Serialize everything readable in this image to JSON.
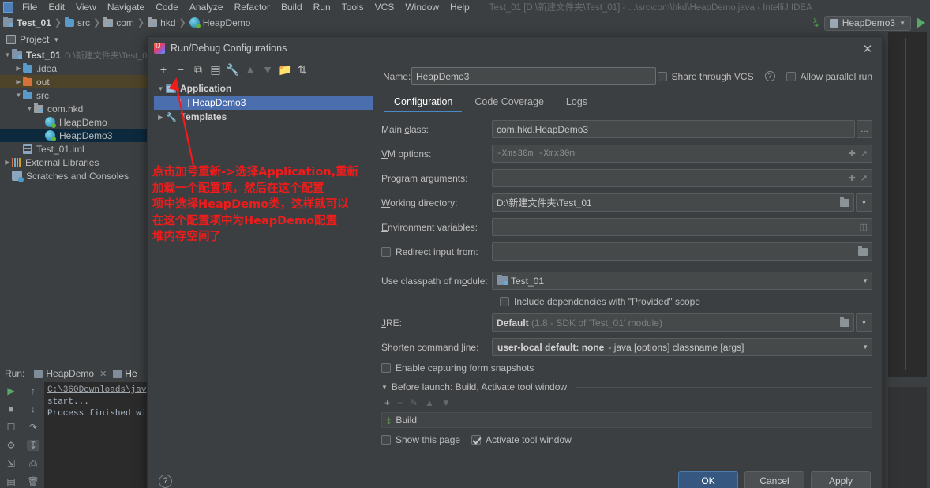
{
  "window": {
    "title": "Test_01 [D:\\新建文件夹\\Test_01] - ...\\src\\com\\hkd\\HeapDemo.java - IntelliJ IDEA",
    "menu": [
      "File",
      "Edit",
      "View",
      "Navigate",
      "Code",
      "Analyze",
      "Refactor",
      "Build",
      "Run",
      "Tools",
      "VCS",
      "Window",
      "Help"
    ]
  },
  "breadcrumb": [
    {
      "label": "Test_01",
      "icon": "module-icon"
    },
    {
      "label": "src",
      "icon": "folder-blue-icon"
    },
    {
      "label": "com",
      "icon": "folder-gray-icon"
    },
    {
      "label": "hkd",
      "icon": "folder-gray-icon"
    },
    {
      "label": "HeapDemo",
      "icon": "class-icon"
    }
  ],
  "toolbar": {
    "build_icon": "hammer-icon",
    "run_config": "HeapDemo3",
    "run_icon": "run-play-icon"
  },
  "project_panel": {
    "title": "Project",
    "tree": [
      {
        "label": "Test_01",
        "detail": "D:\\新建文件夹\\Test_0",
        "indent": 0,
        "arrow": "▼",
        "icon": "module-icon",
        "bold": true,
        "state": "none"
      },
      {
        "label": ".idea",
        "detail": "",
        "indent": 1,
        "arrow": "▶",
        "icon": "folder-blue-icon",
        "bold": false,
        "state": "none"
      },
      {
        "label": "out",
        "detail": "",
        "indent": 1,
        "arrow": "▶",
        "icon": "folder-orange-icon",
        "bold": false,
        "state": "highlight"
      },
      {
        "label": "src",
        "detail": "",
        "indent": 1,
        "arrow": "▼",
        "icon": "folder-blue-icon",
        "bold": false,
        "state": "none"
      },
      {
        "label": "com.hkd",
        "detail": "",
        "indent": 2,
        "arrow": "▼",
        "icon": "folder-gray-icon",
        "bold": false,
        "state": "none"
      },
      {
        "label": "HeapDemo",
        "detail": "",
        "indent": 3,
        "arrow": "",
        "icon": "class-icon",
        "bold": false,
        "state": "none"
      },
      {
        "label": "HeapDemo3",
        "detail": "",
        "indent": 3,
        "arrow": "",
        "icon": "class-icon",
        "bold": false,
        "state": "selected"
      },
      {
        "label": "Test_01.iml",
        "detail": "",
        "indent": 1,
        "arrow": "",
        "icon": "iml-icon",
        "bold": false,
        "state": "none"
      },
      {
        "label": "External Libraries",
        "detail": "",
        "indent": 0,
        "arrow": "▶",
        "icon": "library-icon",
        "bold": false,
        "state": "none"
      },
      {
        "label": "Scratches and Consoles",
        "detail": "",
        "indent": 0,
        "arrow": "",
        "icon": "scratches-icon",
        "bold": false,
        "state": "none"
      }
    ]
  },
  "run_tool_window": {
    "label": "Run:",
    "tabs": [
      {
        "label": "HeapDemo",
        "active": false
      },
      {
        "label": "He",
        "active": true
      }
    ],
    "console_lines": [
      "C:\\360Downloads\\jav",
      "start...",
      "",
      "Process finished wi"
    ],
    "toolbar_icons": [
      "rerun-icon",
      "stop-icon",
      "camera-icon",
      "settings-gear-icon",
      "export-icon",
      "layout-icon",
      "scroll-up-icon",
      "scroll-down-icon",
      "soft-wrap-icon",
      "scroll-to-end-icon",
      "print-icon",
      "trash-icon"
    ]
  },
  "dialog": {
    "title": "Run/Debug Configurations",
    "close_label": "✕",
    "toolbar": [
      {
        "name": "add-button",
        "glyph": "+",
        "disabled": false,
        "highlighted": true
      },
      {
        "name": "remove-button",
        "glyph": "−",
        "disabled": false,
        "highlighted": false
      },
      {
        "name": "copy-button",
        "glyph": "⧉",
        "disabled": false,
        "highlighted": false
      },
      {
        "name": "save-button",
        "glyph": "▤",
        "disabled": false,
        "highlighted": false
      },
      {
        "name": "edit-templates-button",
        "glyph": "🔧",
        "disabled": false,
        "highlighted": false
      },
      {
        "name": "move-up-button",
        "glyph": "▲",
        "disabled": true,
        "highlighted": false
      },
      {
        "name": "move-down-button",
        "glyph": "▼",
        "disabled": true,
        "highlighted": false
      },
      {
        "name": "new-folder-button",
        "glyph": "🗀",
        "disabled": false,
        "highlighted": false
      },
      {
        "name": "sort-button",
        "glyph": "⇅",
        "disabled": false,
        "highlighted": false
      }
    ],
    "config_tree": [
      {
        "label": "Application",
        "indent": 0,
        "arrow": "▼",
        "icon": "app-folder-icon",
        "bold": true,
        "selected": false
      },
      {
        "label": "HeapDemo3",
        "indent": 1,
        "arrow": "",
        "icon": "config-icon",
        "bold": false,
        "selected": true
      },
      {
        "label": "Templates",
        "indent": 0,
        "arrow": "▶",
        "icon": "wrench-icon",
        "bold": true,
        "selected": false
      }
    ],
    "name_label": "Name:",
    "name_value": "HeapDemo3",
    "share_vcs_label": "Share through VCS",
    "share_vcs_checked": false,
    "allow_parallel_label": "Allow parallel run",
    "allow_parallel_checked": false,
    "tabs": [
      {
        "label": "Configuration",
        "active": true
      },
      {
        "label": "Code Coverage",
        "active": false
      },
      {
        "label": "Logs",
        "active": false
      }
    ],
    "fields": {
      "main_class_label": "Main class:",
      "main_class_value": "com.hkd.HeapDemo3",
      "main_class_browse": "...",
      "vm_options_label": "VM options:",
      "vm_options_value": "-Xms30m  -Xmx30m",
      "program_args_label": "Program arguments:",
      "program_args_value": "",
      "working_dir_label": "Working directory:",
      "working_dir_value": "D:\\新建文件夹\\Test_01",
      "env_vars_label": "Environment variables:",
      "env_vars_value": "",
      "redirect_input_label": "Redirect input from:",
      "redirect_input_checked": false,
      "redirect_input_value": "",
      "classpath_label": "Use classpath of module:",
      "classpath_value": "Test_01",
      "include_provided_label": "Include dependencies with \"Provided\" scope",
      "include_provided_checked": false,
      "jre_label": "JRE:",
      "jre_value": "Default",
      "jre_hint": "(1.8 - SDK of 'Test_01' module)",
      "shorten_label": "Shorten command line:",
      "shorten_value": "user-local default: none",
      "shorten_hint": "- java [options] classname [args]",
      "capture_snapshots_label": "Enable capturing form snapshots",
      "capture_snapshots_checked": false
    },
    "before_launch": {
      "header": "Before launch: Build, Activate tool window",
      "tools": [
        "+",
        "−",
        "✎",
        "▲",
        "▼"
      ],
      "items": [
        {
          "label": "Build",
          "icon": "hammer-icon"
        }
      ],
      "show_page_label": "Show this page",
      "show_page_checked": false,
      "activate_window_label": "Activate tool window",
      "activate_window_checked": true
    },
    "footer": {
      "help_glyph": "?",
      "buttons": [
        {
          "label": "OK",
          "primary": true
        },
        {
          "label": "Cancel",
          "primary": false
        },
        {
          "label": "Apply",
          "primary": false
        }
      ]
    }
  },
  "annotation": {
    "text": "点击加号重新->选择Application,重新\n加载一个配置项，然后在这个配置\n项中选择HeapDemo类，这样就可以\n在这个配置项中为HeapDemo配置\n堆内存空间了",
    "color": "#f01b1b"
  }
}
